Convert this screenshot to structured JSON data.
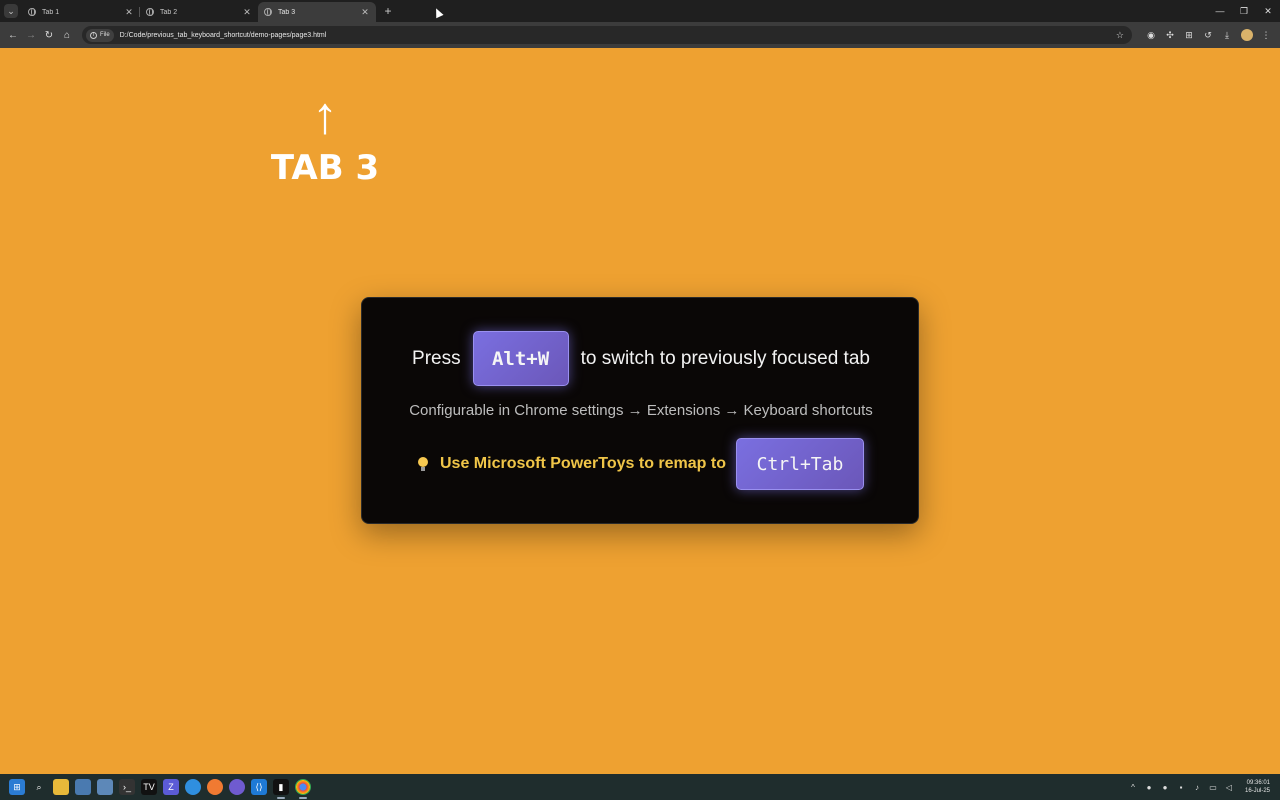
{
  "browser": {
    "tabs": [
      {
        "label": "Tab 1",
        "active": false
      },
      {
        "label": "Tab 2",
        "active": false
      },
      {
        "label": "Tab 3",
        "active": true
      }
    ],
    "newtab_label": "+",
    "address": {
      "chip_label": "File",
      "url": "D:/Code/previous_tab_keyboard_shortcut/demo-pages/page3.html"
    }
  },
  "page": {
    "background_color": "#eea131",
    "arrow": "↑",
    "tab_title": "TAB 3",
    "card": {
      "press_label": "Press",
      "shortcut_key": "Alt+W",
      "action_text": "to switch to previously focused tab",
      "config_text": "Configurable in Chrome settings → Extensions → Keyboard shortcuts",
      "tip_text": "Use Microsoft PowerToys to remap to",
      "remap_key": "Ctrl+Tab"
    }
  },
  "taskbar": {
    "clock_time": "09:36:01",
    "clock_date": "16-Jul-25"
  }
}
